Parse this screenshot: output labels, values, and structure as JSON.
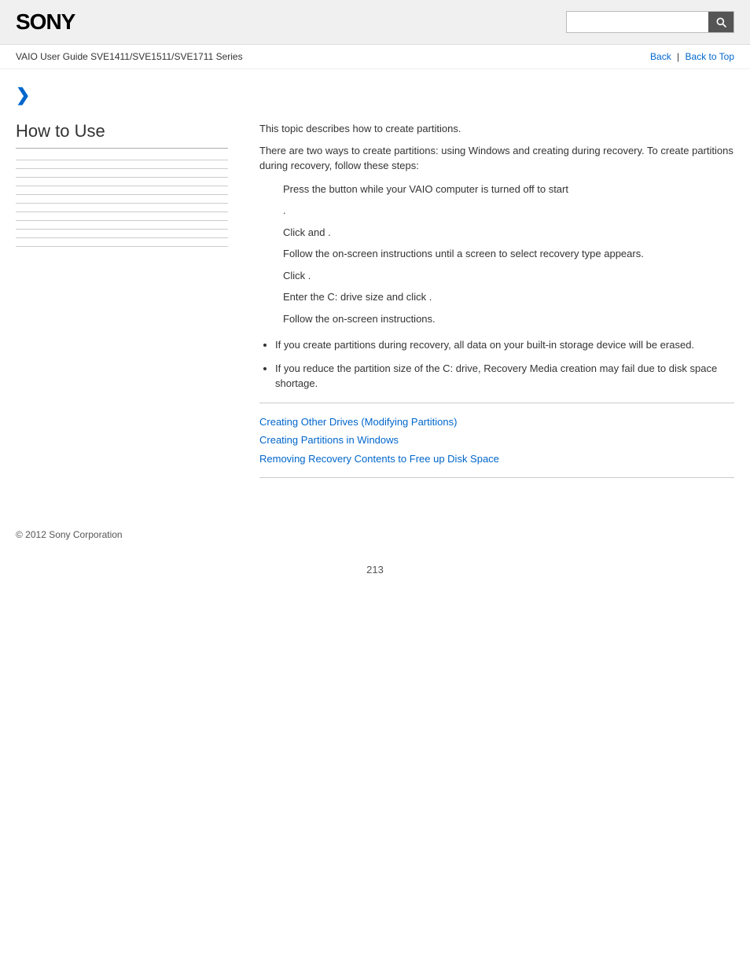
{
  "header": {
    "logo": "SONY",
    "search_placeholder": ""
  },
  "breadcrumb": {
    "guide_title": "VAIO User Guide SVE1411/SVE1511/SVE1711 Series",
    "back_label": "Back",
    "back_to_top_label": "Back to Top"
  },
  "chevron": "❯",
  "sidebar": {
    "title": "How to Use",
    "items": [
      {
        "label": ""
      },
      {
        "label": ""
      },
      {
        "label": ""
      },
      {
        "label": ""
      },
      {
        "label": ""
      },
      {
        "label": ""
      },
      {
        "label": ""
      },
      {
        "label": ""
      },
      {
        "label": ""
      },
      {
        "label": ""
      },
      {
        "label": ""
      }
    ]
  },
  "content": {
    "intro_1": "This topic describes how to create partitions.",
    "intro_2": "There are two ways to create partitions: using Windows and creating during recovery. To create partitions during recovery, follow these steps:",
    "steps": [
      {
        "text": "Press the        button while your VAIO computer is turned off to start"
      },
      {
        "text": "."
      },
      {
        "text": "Click        and                             ."
      },
      {
        "text": "Follow the on-screen instructions until a screen to select recovery type appears."
      },
      {
        "text": "Click                                                              ."
      },
      {
        "text": "Enter the C: drive size and click        ."
      },
      {
        "text": "Follow the on-screen instructions."
      }
    ],
    "bullets": [
      "If you create partitions during recovery, all data on your built-in storage device will be erased.",
      "If you reduce the partition size of the C: drive, Recovery Media creation may fail due to disk space shortage."
    ],
    "related_links": [
      {
        "label": "Creating Other Drives (Modifying Partitions)",
        "href": "#"
      },
      {
        "label": "Creating Partitions in Windows",
        "href": "#"
      },
      {
        "label": "Removing Recovery Contents to Free up Disk Space",
        "href": "#"
      }
    ]
  },
  "footer": {
    "copyright": "© 2012 Sony Corporation"
  },
  "page_number": "213"
}
